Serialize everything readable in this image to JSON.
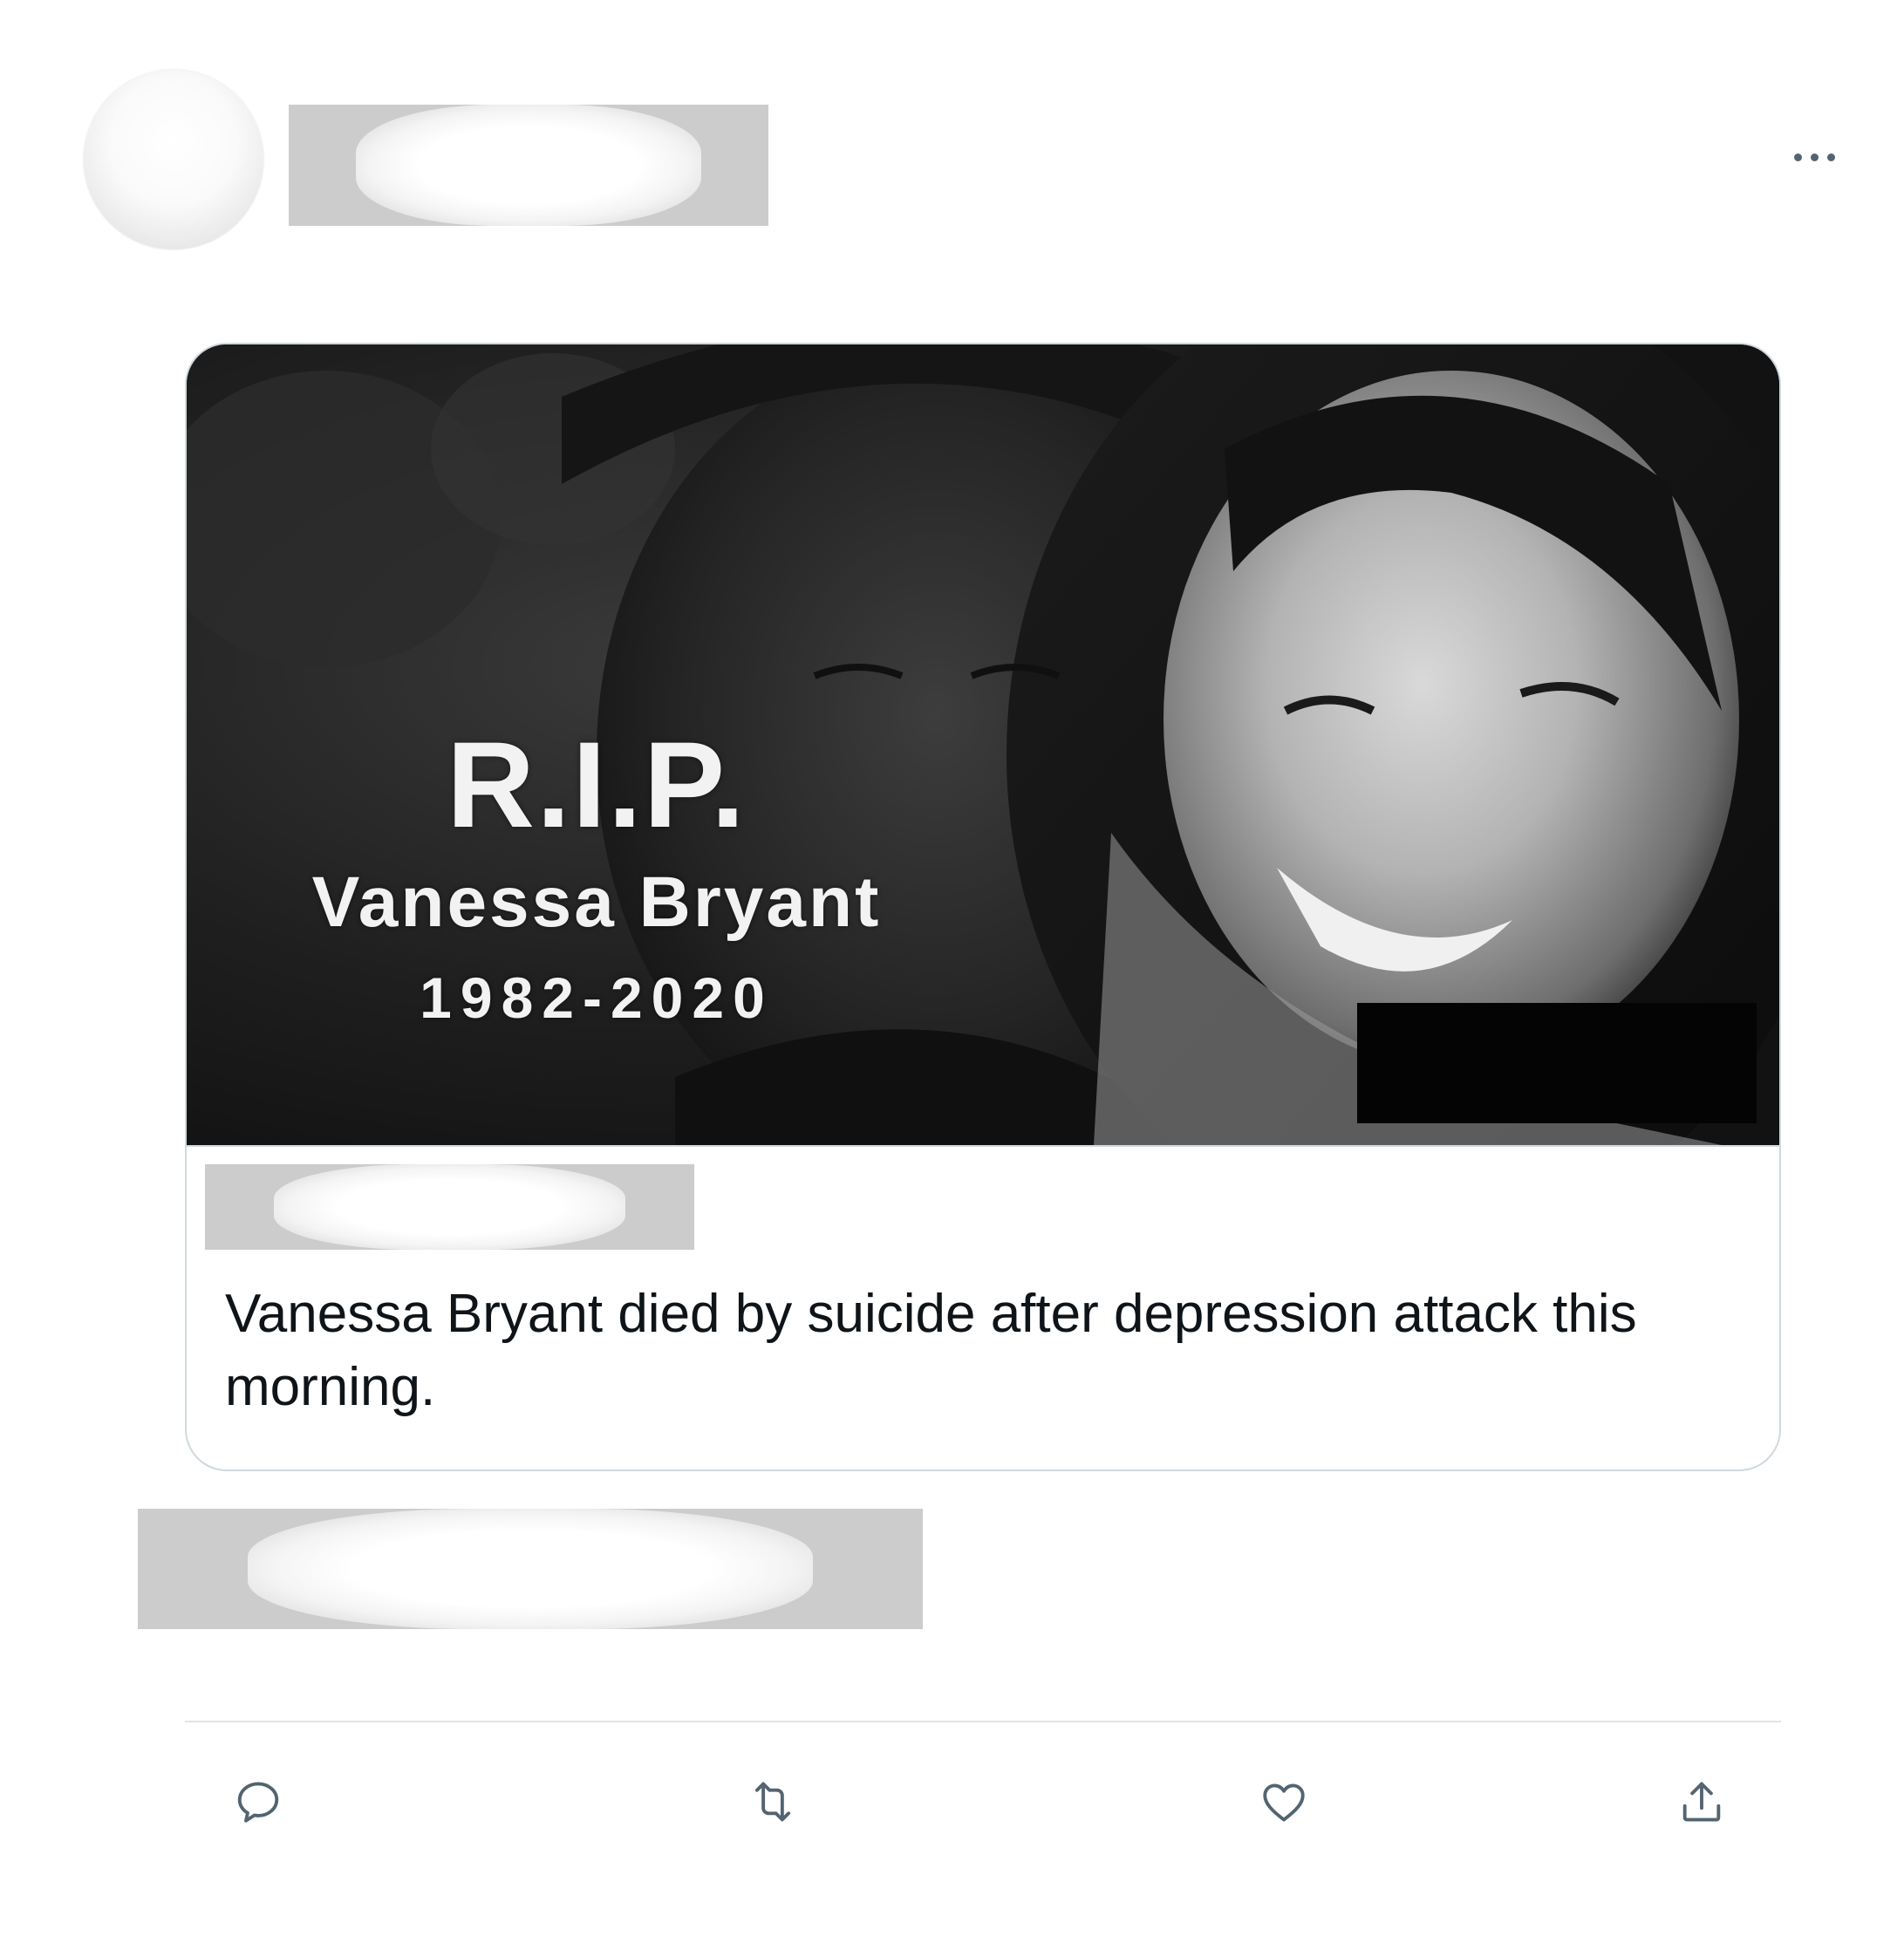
{
  "tweet": {
    "more_label": "More",
    "quoted": {
      "image": {
        "rip_title": "R.I.P.",
        "rip_name": "Vanessa Bryant",
        "rip_years": "1982-2020"
      },
      "text": "Vanessa Bryant died by suicide after depression attack this morning."
    },
    "actions": {
      "reply_icon": "reply-icon",
      "retweet_icon": "retweet-icon",
      "like_icon": "heart-icon",
      "share_icon": "share-icon"
    },
    "colors": {
      "icon": "#536471",
      "border": "#cfd9de",
      "text": "#0f1419",
      "redaction": "#cccccc"
    }
  }
}
